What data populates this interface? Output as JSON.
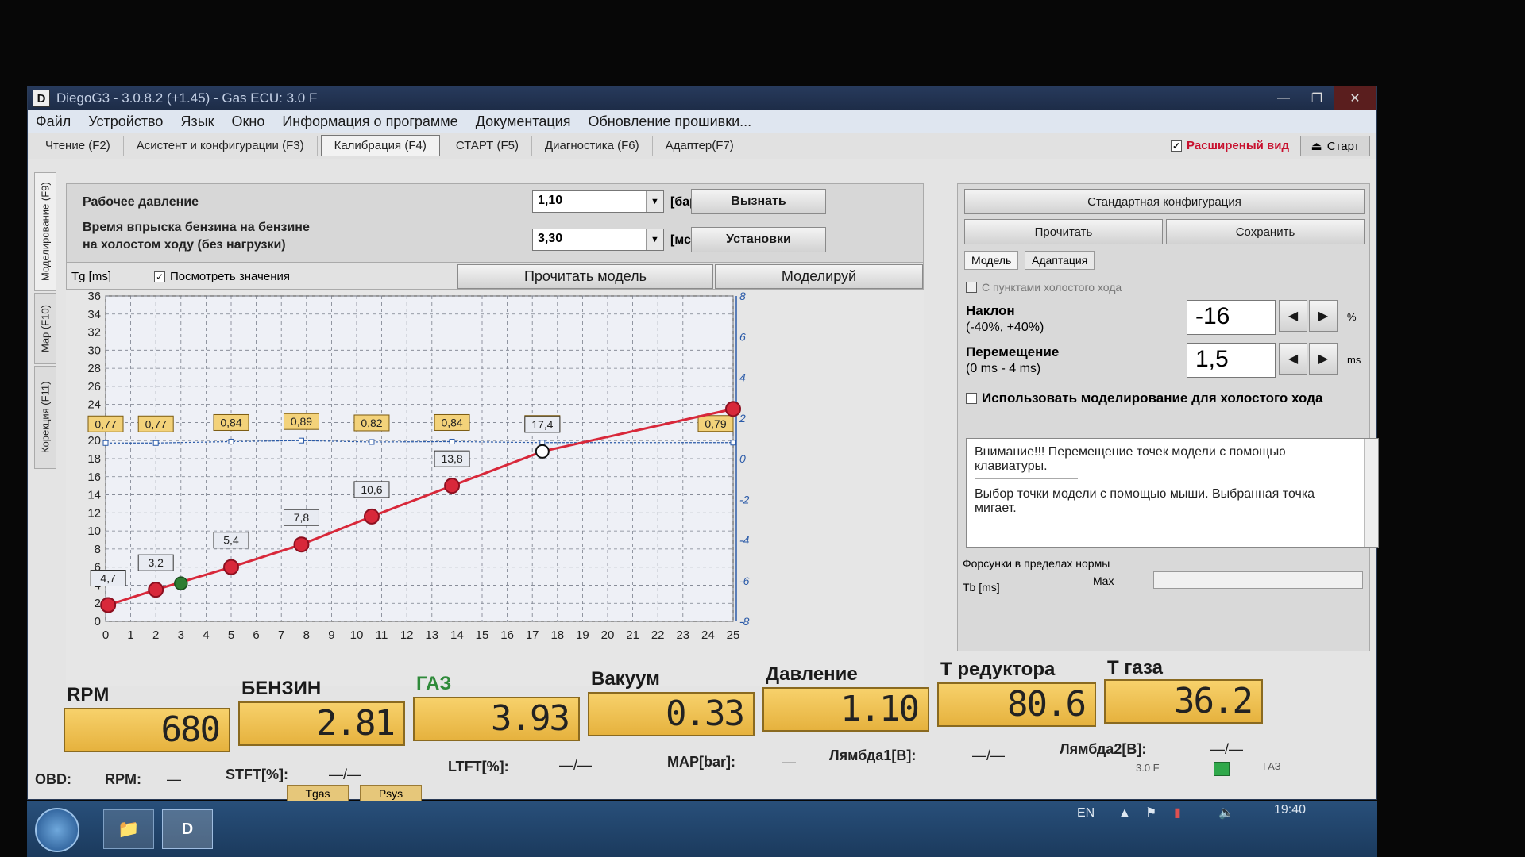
{
  "window": {
    "title": "DiegoG3 - 3.0.8.2 (+1.45) - Gas ECU: 3.0 F"
  },
  "menu": [
    "Файл",
    "Устройство",
    "Язык",
    "Окно",
    "Информация о программе",
    "Документация",
    "Обновление прошивки..."
  ],
  "tabs": [
    "Чтение (F2)",
    "Асистент и конфигурации (F3)",
    "Калибрация (F4)",
    "СТАРТ (F5)",
    "Диагностика (F6)",
    "Адаптер(F7)"
  ],
  "extended_view": "Расширеный вид",
  "start_button": "Старт",
  "vertical_tabs": [
    "Моделирование (F9)",
    "Map (F10)",
    "Корекция (F11)"
  ],
  "params": {
    "pressure_label": "Рабочее давление",
    "pressure_value": "1,10",
    "pressure_unit": "[бар]",
    "call_button": "Вызнать",
    "injection_label_1": "Время впрыска бензина на бензине",
    "injection_label_2": "на холостом ходу (без нагрузки)",
    "injection_value": "3,30",
    "injection_unit": "[мс]",
    "settings_button": "Установки"
  },
  "chart_toolbar": {
    "axis_label": "Tg [ms]",
    "show_values": "Посмотреть значения",
    "read_model": "Прочитать модель",
    "simulate": "Моделируй"
  },
  "chart_data": {
    "type": "line",
    "x_ticks": [
      0,
      1,
      2,
      3,
      4,
      5,
      6,
      7,
      8,
      9,
      10,
      11,
      12,
      13,
      14,
      15,
      16,
      17,
      18,
      19,
      20,
      21,
      22,
      23,
      24,
      25
    ],
    "y_ticks": [
      0,
      2,
      4,
      6,
      8,
      10,
      12,
      14,
      16,
      18,
      20,
      22,
      24,
      26,
      28,
      30,
      32,
      34,
      36
    ],
    "y2_ticks": [
      -8,
      -6,
      -4,
      -2,
      0,
      2,
      4,
      6,
      8
    ],
    "xlim": [
      0,
      25
    ],
    "ylim": [
      0,
      36
    ],
    "y2lim": [
      -8,
      8
    ],
    "grid": true,
    "series": [
      {
        "x": [
          0.1,
          2,
          5,
          7.8,
          10.6,
          13.8,
          17.4,
          25
        ],
        "y": [
          1.8,
          3.5,
          6,
          8.5,
          11.6,
          15,
          18.8,
          23.5
        ],
        "point_labels": [
          "4,7",
          "3,2",
          "5,4",
          "7,8",
          "10,6",
          "13,8",
          "17,4",
          ""
        ],
        "color": "#d8283a"
      },
      {
        "x": [
          0,
          2,
          5,
          7.8,
          10.6,
          13.8,
          17.4,
          25
        ],
        "y": [
          0.77,
          0.77,
          0.84,
          0.89,
          0.82,
          0.84,
          0.79,
          0.79
        ],
        "point_labels": [
          "0,77",
          "0,77",
          "0,84",
          "0,89",
          "0,82",
          "0,84",
          "0,79",
          "0,79"
        ],
        "axis": "right",
        "color": "#2a5aa8"
      }
    ],
    "current_point": {
      "x": 3,
      "y": 4.2,
      "color": "#2e7d32"
    }
  },
  "right_panel": {
    "std_config": "Стандартная конфигурация",
    "read": "Прочитать",
    "save": "Сохранить",
    "tab_model": "Модель",
    "tab_adapt": "Адаптация",
    "idle_points": "С пунктами холостого хода",
    "slope_label": "Наклон",
    "slope_range": "(-40%, +40%)",
    "slope_value": "-16",
    "slope_unit": "%",
    "shift_label": "Перемещение",
    "shift_range": "(0 ms - 4 ms)",
    "shift_value": "1,5",
    "shift_unit": "ms",
    "use_idle": "Использовать моделирование для холостого хода",
    "notice_1": "Внимание!!! Перемещение точек модели с помощью клавиатуры.",
    "notice_2": "Выбор точки модели с помощью мыши. Выбранная точка мигает.",
    "injectors": "Форсунки в пределах нормы",
    "tb_label": "Tb [ms]",
    "max_label": "Max"
  },
  "indicators": [
    {
      "label": "RPM",
      "value": "680"
    },
    {
      "label": "БЕНЗИН",
      "value": "2.81"
    },
    {
      "label": "ГАЗ",
      "value": "3.93"
    },
    {
      "label": "Вакуум",
      "value": "0.33"
    },
    {
      "label": "Давление",
      "value": "1.10"
    },
    {
      "label": "Т редуктора",
      "value": "80.6"
    },
    {
      "label": "Т газа",
      "value": "36.2"
    }
  ],
  "obd": {
    "obd": "OBD:",
    "rpm": "RPM:",
    "rpm_val": "—",
    "stft": "STFT[%]:",
    "stft_val": "—/—",
    "ltft": "LTFT[%]:",
    "ltft_val": "—/—",
    "map": "MAP[bar]:",
    "map_val": "—",
    "lambda1": "Лямбда1[В]:",
    "lambda1_val": "—/—",
    "lambda2": "Лямбда2[В]:",
    "lambda2_val": "—/—",
    "ecu": "3.0 F",
    "fuel": "ГАЗ"
  },
  "bottom_buttons": [
    "Tgas",
    "Psys"
  ],
  "taskbar": {
    "lang": "EN",
    "time": "19:40"
  }
}
